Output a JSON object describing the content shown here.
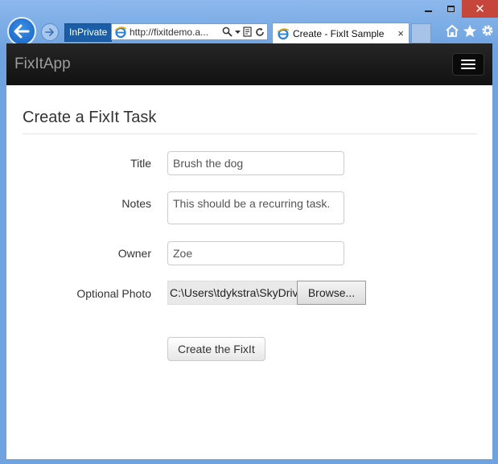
{
  "browser": {
    "inprivate_label": "InPrivate",
    "address": "http://fixitdemo.a...",
    "tab_title": "Create - FixIt Sample",
    "tab_close": "×",
    "close_glyph": "✕",
    "accent": "#1b5ea6",
    "close_color": "#c7463c"
  },
  "navbar": {
    "brand": "FixItApp",
    "menu_icon": "hamburger-icon"
  },
  "page": {
    "title": "Create a FixIt Task"
  },
  "form": {
    "title": {
      "label": "Title",
      "value": "Brush the dog"
    },
    "notes": {
      "label": "Notes",
      "value": "This should be a recurring task."
    },
    "owner": {
      "label": "Owner",
      "value": "Zoe"
    },
    "photo": {
      "label": "Optional Photo",
      "path": "C:\\Users\\tdykstra\\SkyDriv",
      "browse_label": "Browse..."
    },
    "submit_label": "Create the FixIt"
  }
}
